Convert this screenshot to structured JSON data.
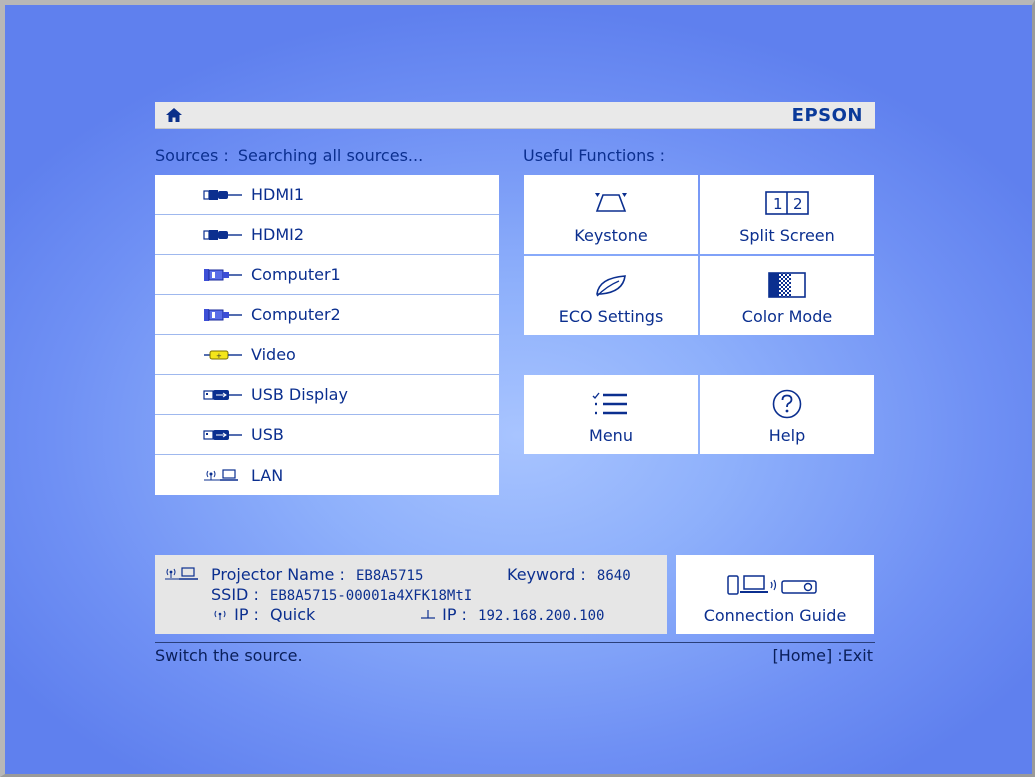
{
  "header": {
    "brand": "EPSON",
    "home_icon": "home-icon"
  },
  "sources": {
    "title": "Sources :",
    "status": "Searching all sources...",
    "items": [
      {
        "label": "HDMI1",
        "icon": "hdmi-icon"
      },
      {
        "label": "HDMI2",
        "icon": "hdmi-icon"
      },
      {
        "label": "Computer1",
        "icon": "vga-icon"
      },
      {
        "label": "Computer2",
        "icon": "vga-icon"
      },
      {
        "label": "Video",
        "icon": "rca-video-icon"
      },
      {
        "label": "USB Display",
        "icon": "usb-icon"
      },
      {
        "label": "USB",
        "icon": "usb-icon"
      },
      {
        "label": "LAN",
        "icon": "lan-icon"
      }
    ]
  },
  "useful_functions": {
    "title": "Useful Functions :",
    "items": [
      {
        "label": "Keystone",
        "icon": "keystone-icon"
      },
      {
        "label": "Split Screen",
        "icon": "split-screen-icon",
        "icon_text": [
          "1",
          "2"
        ]
      },
      {
        "label": "ECO Settings",
        "icon": "leaf-icon"
      },
      {
        "label": "Color Mode",
        "icon": "color-mode-icon"
      },
      {
        "label": "Menu",
        "icon": "menu-list-icon"
      },
      {
        "label": "Help",
        "icon": "help-icon"
      }
    ]
  },
  "network_info": {
    "projector_name_label": "Projector Name :",
    "projector_name": "EB8A5715",
    "keyword_label": "Keyword :",
    "keyword": "8640",
    "ssid_label": "SSID :",
    "ssid": "EB8A5715-00001a4XFK18MtI",
    "wireless_ip_label": "IP :",
    "wireless_ip": "Quick",
    "wired_ip_label": "IP :",
    "wired_ip": "192.168.200.100"
  },
  "connection_guide": {
    "label": "Connection Guide",
    "icon": "connection-guide-icon"
  },
  "status_bar": {
    "hint": "Switch the source.",
    "exit_hint": "[Home] :Exit"
  },
  "colors": {
    "text": "#0b2f8f",
    "background": "#8eb0fb",
    "tile": "#ffffff",
    "panel": "#e6e6e6"
  }
}
